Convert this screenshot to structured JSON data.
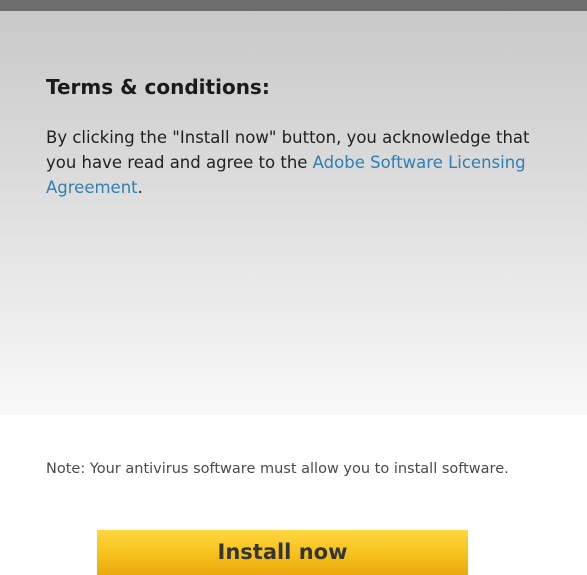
{
  "terms": {
    "title": "Terms & conditions:",
    "text_before_link": "By clicking the \"Install now\" button, you acknowledge that you have read and agree to the ",
    "link_label": "Adobe Software Licensing Agreement",
    "text_after_link": "."
  },
  "note": {
    "text": "Note: Your antivirus software must allow you to install software."
  },
  "install_button": {
    "label": "Install now"
  },
  "colors": {
    "link": "#2f7fb0",
    "button_top": "#ffd740",
    "button_bottom": "#eaa80d",
    "top_strip": "#6e6e6e"
  }
}
